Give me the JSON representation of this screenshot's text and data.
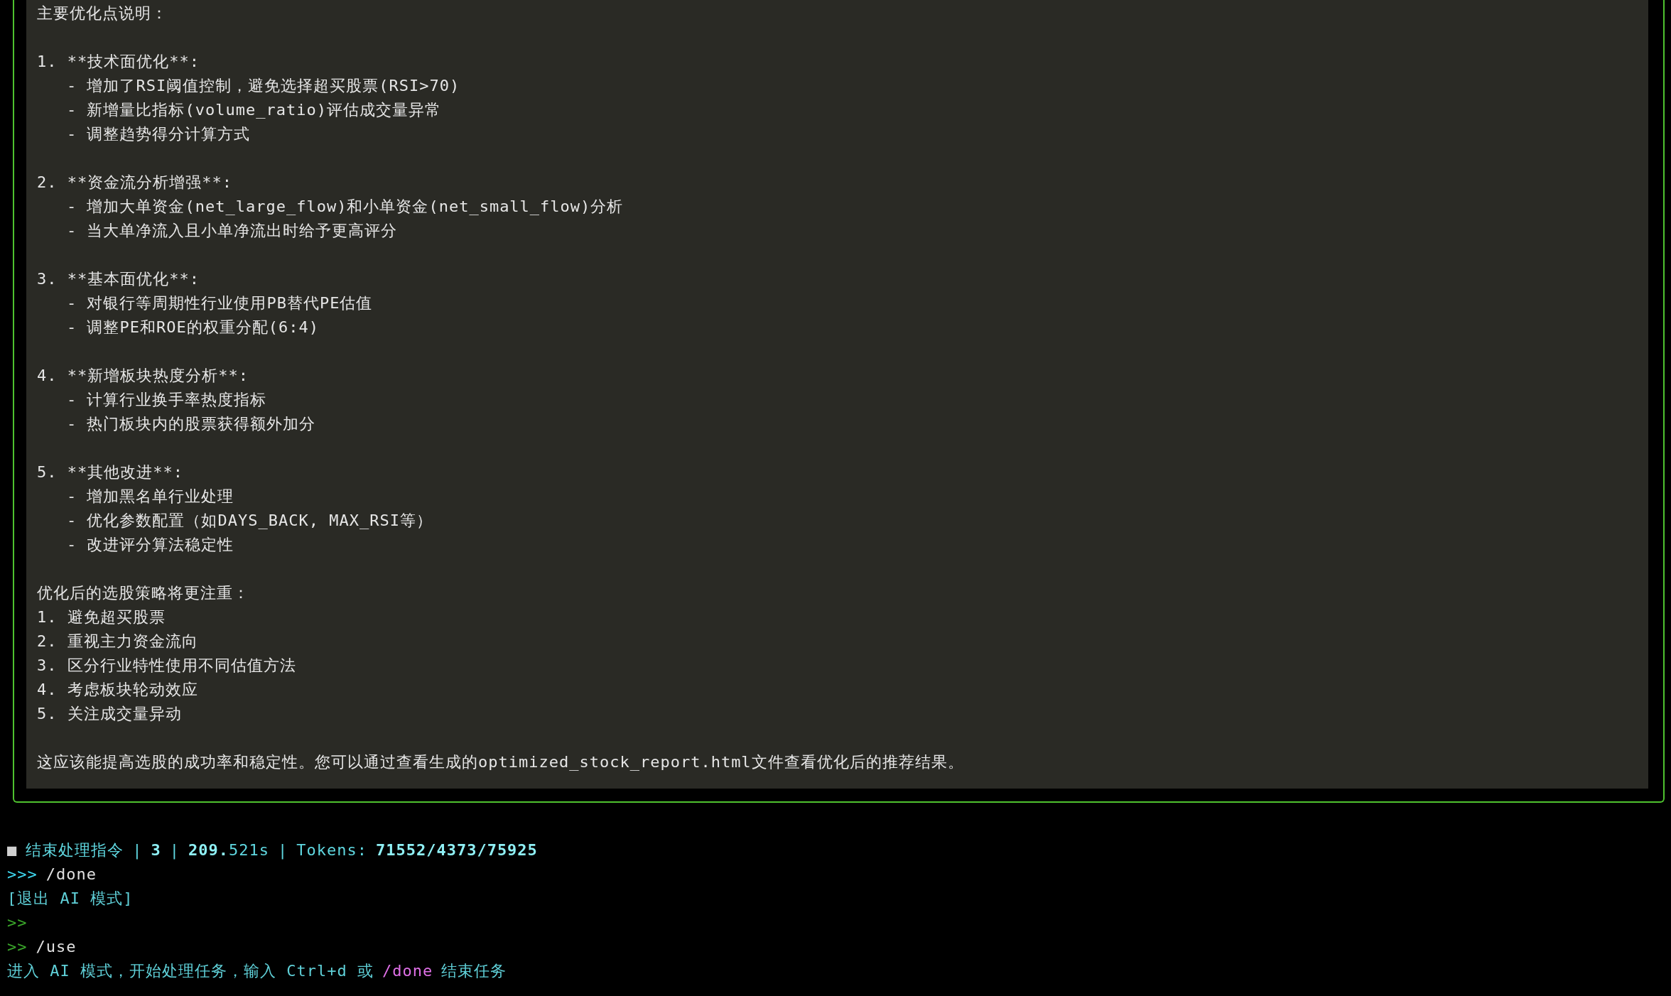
{
  "panel": {
    "blocks": [
      {
        "lines": [
          {
            "kind": "text",
            "text": "主要优化点说明："
          }
        ]
      },
      {
        "lines": [
          {
            "kind": "text",
            "text": "1. **技术面优化**:"
          },
          {
            "kind": "bullet",
            "text": "- 增加了RSI阈值控制，避免选择超买股票(RSI>70)"
          },
          {
            "kind": "bullet",
            "text": "- 新增量比指标(volume_ratio)评估成交量异常"
          },
          {
            "kind": "bullet",
            "text": "- 调整趋势得分计算方式"
          }
        ]
      },
      {
        "lines": [
          {
            "kind": "text",
            "text": "2. **资金流分析增强**:"
          },
          {
            "kind": "bullet",
            "text": "- 增加大单资金(net_large_flow)和小单资金(net_small_flow)分析"
          },
          {
            "kind": "bullet",
            "text": "- 当大单净流入且小单净流出时给予更高评分"
          }
        ]
      },
      {
        "lines": [
          {
            "kind": "text",
            "text": "3. **基本面优化**:"
          },
          {
            "kind": "bullet",
            "text": "- 对银行等周期性行业使用PB替代PE估值"
          },
          {
            "kind": "bullet",
            "text": "- 调整PE和ROE的权重分配(6:4)"
          }
        ]
      },
      {
        "lines": [
          {
            "kind": "text",
            "text": "4. **新增板块热度分析**:"
          },
          {
            "kind": "bullet",
            "text": "- 计算行业换手率热度指标"
          },
          {
            "kind": "bullet",
            "text": "- 热门板块内的股票获得额外加分"
          }
        ]
      },
      {
        "lines": [
          {
            "kind": "text",
            "text": "5. **其他改进**:"
          },
          {
            "kind": "bullet",
            "text": "- 增加黑名单行业处理"
          },
          {
            "kind": "bullet",
            "text": "- 优化参数配置（如DAYS_BACK, MAX_RSI等）"
          },
          {
            "kind": "bullet",
            "text": "- 改进评分算法稳定性"
          }
        ]
      },
      {
        "lines": [
          {
            "kind": "text",
            "text": "优化后的选股策略将更注重："
          },
          {
            "kind": "text",
            "text": "1. 避免超买股票"
          },
          {
            "kind": "text",
            "text": "2. 重视主力资金流向"
          },
          {
            "kind": "text",
            "text": "3. 区分行业特性使用不同估值方法"
          },
          {
            "kind": "text",
            "text": "4. 考虑板块轮动效应"
          },
          {
            "kind": "text",
            "text": "5. 关注成交量异动"
          }
        ]
      },
      {
        "lines": [
          {
            "kind": "text",
            "text": "这应该能提高选股的成功率和稳定性。您可以通过查看生成的optimized_stock_report.html文件查看优化后的推荐结果。"
          }
        ]
      }
    ]
  },
  "status_line": {
    "marker": "■",
    "segments": [
      {
        "text": "结束处理指令",
        "bold": false
      },
      {
        "text": "|",
        "bold": false
      },
      {
        "text": "3",
        "bold": true
      },
      {
        "text": "|",
        "bold": false
      },
      {
        "text": "209.",
        "bold": true
      },
      {
        "text": "521s",
        "bold": false,
        "joined": true
      },
      {
        "text": "|",
        "bold": false
      },
      {
        "text": "Tokens:",
        "bold": false
      },
      {
        "text": "71552/4373/75925",
        "bold": true
      }
    ]
  },
  "terminal_lines": [
    {
      "kind": "ai_prompt",
      "prompt": ">>>",
      "command": "/done"
    },
    {
      "kind": "message",
      "segments": [
        {
          "kind": "plain",
          "text": "[退出 AI 模式]"
        }
      ]
    },
    {
      "kind": "shell_prompt",
      "prompt": ">>"
    },
    {
      "kind": "shell_prompt",
      "prompt": ">>",
      "command": "/use"
    },
    {
      "kind": "message",
      "segments": [
        {
          "kind": "plain",
          "text": "进入 AI 模式，开始处理任务，输入 Ctrl+d 或"
        },
        {
          "kind": "command",
          "text": "/done"
        },
        {
          "kind": "plain",
          "text": "结束任务"
        }
      ]
    }
  ]
}
